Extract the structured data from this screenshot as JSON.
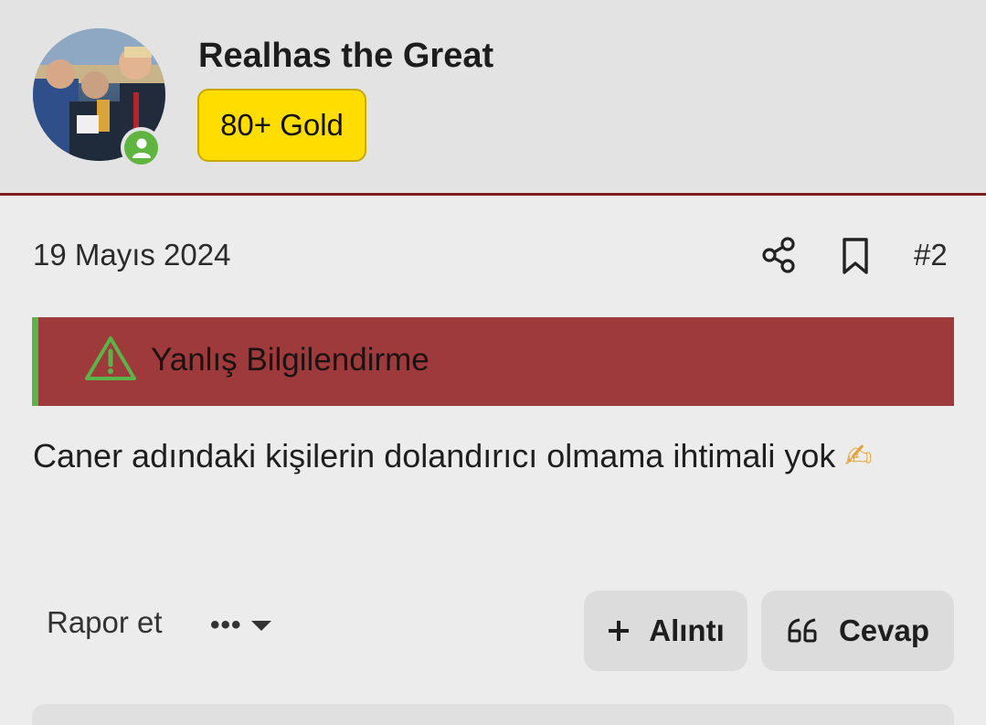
{
  "user": {
    "name": "Realhas the Great",
    "badge": "80+ Gold",
    "status": "online"
  },
  "post": {
    "date": "19 Mayıs 2024",
    "number": "#2",
    "warning_label": "Yanlış Bilgilendirme",
    "body_text": "Caner adındaki kişilerin dolandırıcı olmama ihtimali yok",
    "body_emoji": "✍"
  },
  "actions": {
    "report": "Rapor et",
    "more": "•••",
    "quote": "Alıntı",
    "reply": "Cevap"
  },
  "icons": {
    "share": "share-icon",
    "bookmark": "bookmark-icon",
    "warning": "warning-triangle-icon",
    "quote": "plus-icon",
    "reply": "quote-marks-icon",
    "online": "user-online-icon"
  },
  "colors": {
    "header_bg": "#e3e3e3",
    "header_border": "#7a1f22",
    "badge_gold": "#ffdd00",
    "warning_bg": "#9e3a3b",
    "warning_accent": "#5cb34a",
    "online_green": "#5fb53f",
    "button_bg": "#dcdcdc"
  }
}
